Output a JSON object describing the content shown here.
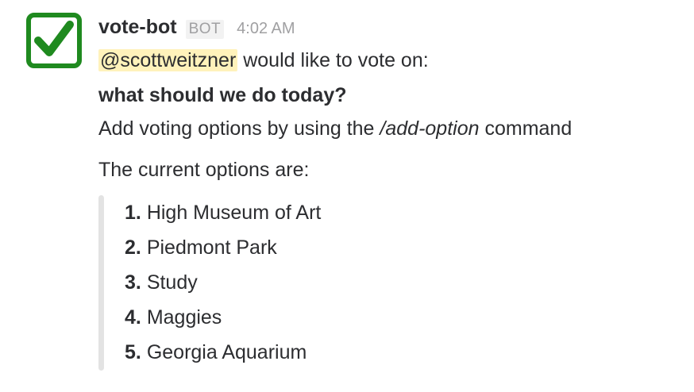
{
  "message": {
    "username": "vote-bot",
    "badge": "BOT",
    "timestamp": "4:02 AM",
    "mention": "@scottweitzner",
    "intro_suffix": " would like to vote on:",
    "question": "what should we do today?",
    "instruction_prefix": "Add voting options by using the ",
    "instruction_command": "/add-option",
    "instruction_suffix": " command",
    "options_heading": "The current options are:",
    "options": [
      {
        "num": "1.",
        "label": "High Museum of Art"
      },
      {
        "num": "2.",
        "label": "Piedmont Park"
      },
      {
        "num": "3.",
        "label": "Study"
      },
      {
        "num": "4.",
        "label": "Maggies"
      },
      {
        "num": "5.",
        "label": "Georgia Aquarium"
      }
    ]
  },
  "avatar": {
    "icon": "checkmark-icon",
    "color": "#1f8a1f"
  }
}
